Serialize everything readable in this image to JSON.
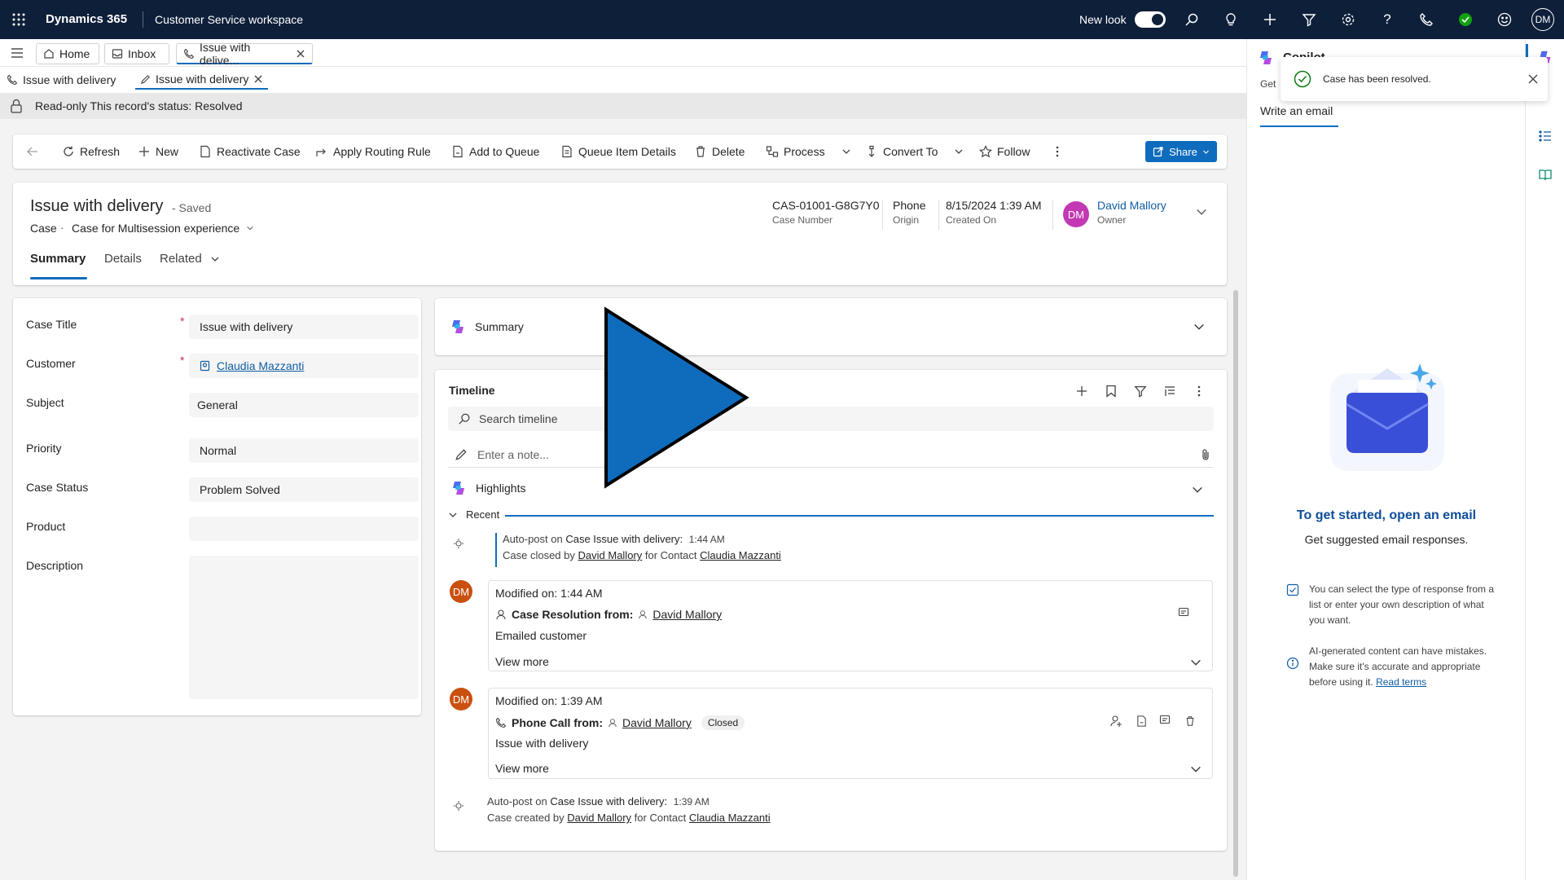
{
  "topbar": {
    "app_name": "Dynamics 365",
    "workspace": "Customer Service workspace",
    "new_look_label": "New look",
    "user_initials": "DM"
  },
  "tabs": {
    "home": "Home",
    "inbox": "Inbox",
    "case_tab": "Issue with delive..."
  },
  "subtabs": {
    "first": "Issue with delivery",
    "second": "Issue with delivery"
  },
  "readonly": {
    "text": "Read-only This record's status: Resolved"
  },
  "commands": {
    "refresh": "Refresh",
    "new": "New",
    "reactivate": "Reactivate Case",
    "routing": "Apply Routing Rule",
    "add_queue": "Add to Queue",
    "queue_details": "Queue Item Details",
    "delete": "Delete",
    "process": "Process",
    "convert": "Convert To",
    "follow": "Follow",
    "share": "Share"
  },
  "header": {
    "title": "Issue with delivery",
    "saved": "- Saved",
    "entity": "Case",
    "form_name": "Case for Multisession experience",
    "case_number": "CAS-01001-G8G7Y0",
    "case_number_label": "Case Number",
    "origin": "Phone",
    "origin_label": "Origin",
    "created_on": "8/15/2024 1:39 AM",
    "created_on_label": "Created On",
    "owner_initials": "DM",
    "owner": "David Mallory",
    "owner_label": "Owner",
    "tabs": [
      "Summary",
      "Details",
      "Related"
    ]
  },
  "form": {
    "case_title_label": "Case Title",
    "case_title": "Issue with delivery",
    "customer_label": "Customer",
    "customer": "Claudia Mazzanti",
    "subject_label": "Subject",
    "subject": "General",
    "priority_label": "Priority",
    "priority": "Normal",
    "status_label": "Case Status",
    "status": "Problem Solved",
    "product_label": "Product",
    "product": "",
    "description_label": "Description",
    "required_mark": "*"
  },
  "summary_section": {
    "label": "Summary"
  },
  "timeline": {
    "title": "Timeline",
    "search_placeholder": "Search timeline",
    "note_placeholder": "Enter a note...",
    "highlights": "Highlights",
    "recent": "Recent",
    "post1": {
      "prefix": "Auto-post on",
      "case": "Case Issue with delivery:",
      "time": "1:44 AM",
      "line2_a": "Case closed by",
      "user": "David Mallory",
      "line2_b": "for Contact",
      "contact": "Claudia Mazzanti"
    },
    "entry1": {
      "initials": "DM",
      "modified": "Modified on: 1:44 AM",
      "kind": "Case Resolution from:",
      "user": "David Mallory",
      "body": "Emailed customer",
      "view_more": "View more"
    },
    "entry2": {
      "initials": "DM",
      "modified": "Modified on: 1:39 AM",
      "kind": "Phone Call from:",
      "user": "David Mallory",
      "badge": "Closed",
      "body": "Issue with delivery",
      "view_more": "View more"
    },
    "post2": {
      "prefix": "Auto-post on",
      "case": "Case Issue with delivery:",
      "time": "1:39 AM",
      "line2_a": "Case created by",
      "user": "David Mallory",
      "line2_b": "for Contact",
      "contact": "Claudia Mazzanti"
    }
  },
  "copilot": {
    "title_fragment": "Copilot",
    "get_fragment": "Get",
    "tab": "Write an email",
    "heading": "To get started, open an email",
    "subheading": "Get suggested email responses.",
    "info1": "You can select the type of response from a list or enter your own description of what you want.",
    "info2": "AI-generated content can have mistakes. Make sure it's accurate and appropriate before using it.",
    "read_terms": "Read terms"
  },
  "toast": {
    "message": "Case has been resolved."
  },
  "colors": {
    "topbar": "#0e1f3a",
    "accent": "#0f6cbd",
    "avatar_pink": "#c239b3",
    "avatar_orange": "#ca5010",
    "success": "#107c10",
    "play_overlay": "#0f6cbd"
  },
  "icons": [
    "waffle-icon",
    "search-icon",
    "lightbulb-icon",
    "plus-icon",
    "filter-icon",
    "gear-icon",
    "help-icon",
    "phone-icon",
    "presence-icon",
    "smiley-icon",
    "hamburger-icon",
    "home-icon",
    "inbox-icon",
    "lock-icon",
    "back-icon",
    "refresh-icon",
    "delete-icon",
    "star-icon",
    "more-icon",
    "copilot-icon",
    "bookmark-icon",
    "attach-icon",
    "pencil-icon",
    "chevron-down-icon",
    "close-icon",
    "check-circle-icon",
    "play-icon"
  ]
}
